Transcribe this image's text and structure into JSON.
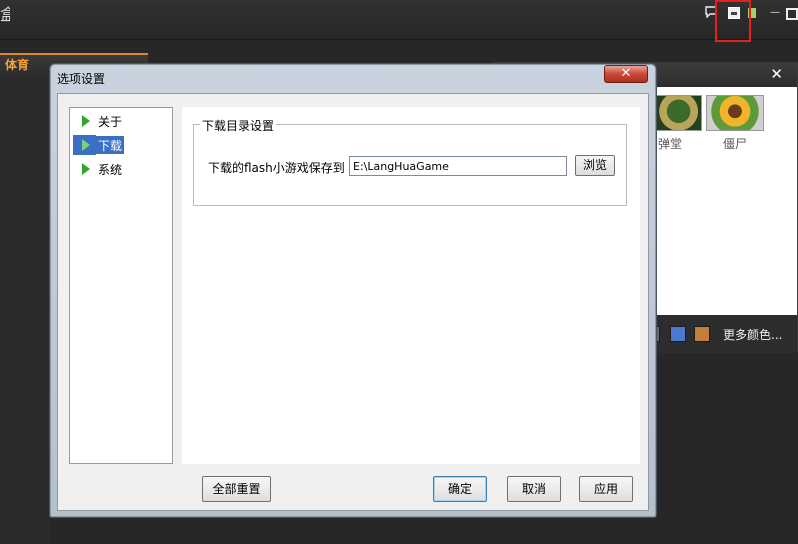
{
  "app": {
    "logo_glyph": "盒",
    "tab_sport": "体育",
    "controls": {
      "chat_icon": "speech-bubble",
      "min_glyph": "—"
    },
    "game_panel": {
      "close_glyph": "✕",
      "games": [
        {
          "label": "弹堂"
        },
        {
          "label": "僵尸"
        }
      ],
      "more_colors": "更多颜色..."
    }
  },
  "dialog": {
    "title": "选项设置",
    "close_glyph": "✕",
    "tree": [
      {
        "label": "关于",
        "selected": false
      },
      {
        "label": "下载",
        "selected": true
      },
      {
        "label": "系统",
        "selected": false
      }
    ],
    "download": {
      "group_title": "下载目录设置",
      "path_label": "下载的flash小游戏保存到",
      "path_value": "E:\\LangHuaGame",
      "browse_label": "浏览"
    },
    "buttons": {
      "reset": "全部重置",
      "ok": "确定",
      "cancel": "取消",
      "apply": "应用"
    }
  },
  "colors": {
    "highlight": "#e81f1f",
    "selection": "#3a6fc4",
    "tab_accent": "#f2a23a"
  }
}
